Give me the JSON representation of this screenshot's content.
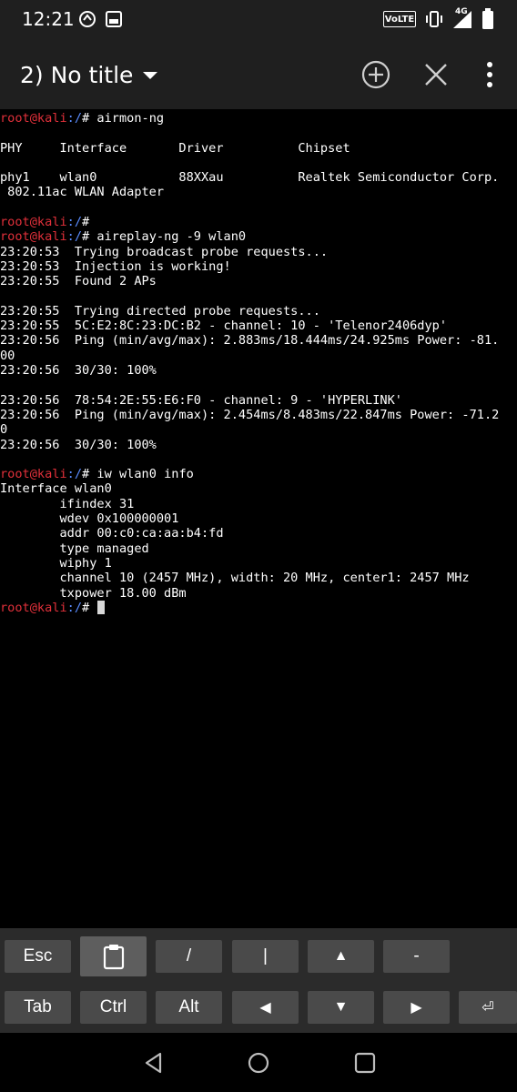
{
  "status_bar": {
    "time": "12:21",
    "icons": [
      "sync-notification-icon",
      "photo-notification-icon",
      "volte-icon",
      "vibrate-icon",
      "signal-4g-icon",
      "battery-icon"
    ],
    "volte_label": "VoLTE",
    "network": "4G"
  },
  "app_bar": {
    "title": "2) No title",
    "icons": [
      "dropdown-icon",
      "add-session-icon",
      "close-session-icon",
      "more-options-icon"
    ]
  },
  "terminal": {
    "prompt_user": "root@kali",
    "prompt_path": ":/",
    "lines": [
      {
        "type": "prompt",
        "cmd": "# airmon-ng"
      },
      {
        "type": "text",
        "text": ""
      },
      {
        "type": "text",
        "text": "PHY     Interface       Driver          Chipset"
      },
      {
        "type": "text",
        "text": ""
      },
      {
        "type": "text",
        "text": "phy1    wlan0           88XXau          Realtek Semiconductor Corp."
      },
      {
        "type": "text",
        "text": " 802.11ac WLAN Adapter"
      },
      {
        "type": "text",
        "text": ""
      },
      {
        "type": "prompt",
        "cmd": "#"
      },
      {
        "type": "prompt",
        "cmd": "# aireplay-ng -9 wlan0"
      },
      {
        "type": "text",
        "text": "23:20:53  Trying broadcast probe requests..."
      },
      {
        "type": "text",
        "text": "23:20:53  Injection is working!"
      },
      {
        "type": "text",
        "text": "23:20:55  Found 2 APs"
      },
      {
        "type": "text",
        "text": ""
      },
      {
        "type": "text",
        "text": "23:20:55  Trying directed probe requests..."
      },
      {
        "type": "text",
        "text": "23:20:55  5C:E2:8C:23:DC:B2 - channel: 10 - 'Telenor2406dyp'"
      },
      {
        "type": "text",
        "text": "23:20:56  Ping (min/avg/max): 2.883ms/18.444ms/24.925ms Power: -81."
      },
      {
        "type": "text",
        "text": "00"
      },
      {
        "type": "text",
        "text": "23:20:56  30/30: 100%"
      },
      {
        "type": "text",
        "text": ""
      },
      {
        "type": "text",
        "text": "23:20:56  78:54:2E:55:E6:F0 - channel: 9 - 'HYPERLINK'"
      },
      {
        "type": "text",
        "text": "23:20:56  Ping (min/avg/max): 2.454ms/8.483ms/22.847ms Power: -71.2"
      },
      {
        "type": "text",
        "text": "0"
      },
      {
        "type": "text",
        "text": "23:20:56  30/30: 100%"
      },
      {
        "type": "text",
        "text": ""
      },
      {
        "type": "prompt",
        "cmd": "# iw wlan0 info"
      },
      {
        "type": "text",
        "text": "Interface wlan0"
      },
      {
        "type": "text",
        "text": "        ifindex 31"
      },
      {
        "type": "text",
        "text": "        wdev 0x100000001"
      },
      {
        "type": "text",
        "text": "        addr 00:c0:ca:aa:b4:fd"
      },
      {
        "type": "text",
        "text": "        type managed"
      },
      {
        "type": "text",
        "text": "        wiphy 1"
      },
      {
        "type": "text",
        "text": "        channel 10 (2457 MHz), width: 20 MHz, center1: 2457 MHz"
      },
      {
        "type": "text",
        "text": "        txpower 18.00 dBm"
      },
      {
        "type": "cursor",
        "cmd": "# "
      }
    ]
  },
  "extra_keys": {
    "row1": [
      {
        "name": "esc-key",
        "label": "Esc"
      },
      {
        "name": "paste-key",
        "label": "",
        "icon": "clipboard-icon"
      },
      {
        "name": "slash-key",
        "label": "/"
      },
      {
        "name": "pipe-key",
        "label": "|"
      },
      {
        "name": "up-arrow-key",
        "label": "▲"
      },
      {
        "name": "dash-key",
        "label": "-"
      }
    ],
    "row2": [
      {
        "name": "tab-key",
        "label": "Tab"
      },
      {
        "name": "ctrl-key",
        "label": "Ctrl"
      },
      {
        "name": "alt-key",
        "label": "Alt"
      },
      {
        "name": "left-arrow-key",
        "label": "◀"
      },
      {
        "name": "down-arrow-key",
        "label": "▼"
      },
      {
        "name": "right-arrow-key",
        "label": "▶"
      },
      {
        "name": "enter-key",
        "label": "⏎"
      }
    ]
  },
  "nav_bar": {
    "icons": [
      "back-icon",
      "home-icon",
      "recents-icon"
    ]
  }
}
